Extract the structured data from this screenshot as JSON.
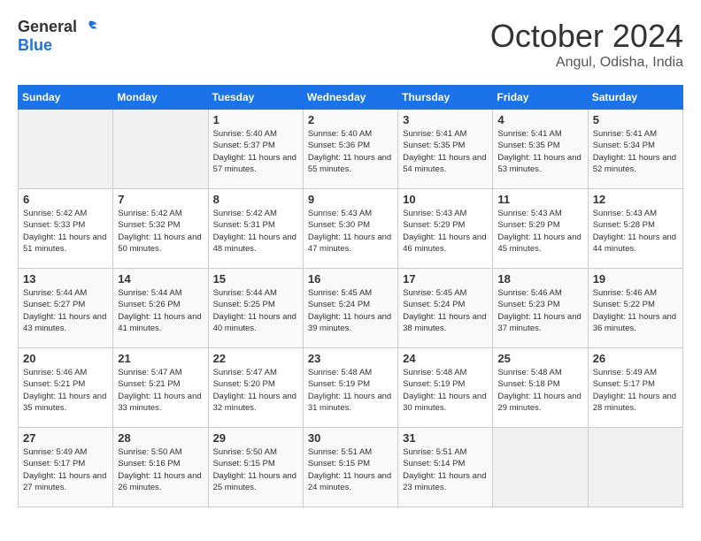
{
  "logo": {
    "general": "General",
    "blue": "Blue"
  },
  "header": {
    "month": "October 2024",
    "location": "Angul, Odisha, India"
  },
  "weekdays": [
    "Sunday",
    "Monday",
    "Tuesday",
    "Wednesday",
    "Thursday",
    "Friday",
    "Saturday"
  ],
  "weeks": [
    [
      {
        "day": "",
        "info": ""
      },
      {
        "day": "",
        "info": ""
      },
      {
        "day": "1",
        "info": "Sunrise: 5:40 AM\nSunset: 5:37 PM\nDaylight: 11 hours and 57 minutes."
      },
      {
        "day": "2",
        "info": "Sunrise: 5:40 AM\nSunset: 5:36 PM\nDaylight: 11 hours and 55 minutes."
      },
      {
        "day": "3",
        "info": "Sunrise: 5:41 AM\nSunset: 5:35 PM\nDaylight: 11 hours and 54 minutes."
      },
      {
        "day": "4",
        "info": "Sunrise: 5:41 AM\nSunset: 5:35 PM\nDaylight: 11 hours and 53 minutes."
      },
      {
        "day": "5",
        "info": "Sunrise: 5:41 AM\nSunset: 5:34 PM\nDaylight: 11 hours and 52 minutes."
      }
    ],
    [
      {
        "day": "6",
        "info": "Sunrise: 5:42 AM\nSunset: 5:33 PM\nDaylight: 11 hours and 51 minutes."
      },
      {
        "day": "7",
        "info": "Sunrise: 5:42 AM\nSunset: 5:32 PM\nDaylight: 11 hours and 50 minutes."
      },
      {
        "day": "8",
        "info": "Sunrise: 5:42 AM\nSunset: 5:31 PM\nDaylight: 11 hours and 48 minutes."
      },
      {
        "day": "9",
        "info": "Sunrise: 5:43 AM\nSunset: 5:30 PM\nDaylight: 11 hours and 47 minutes."
      },
      {
        "day": "10",
        "info": "Sunrise: 5:43 AM\nSunset: 5:29 PM\nDaylight: 11 hours and 46 minutes."
      },
      {
        "day": "11",
        "info": "Sunrise: 5:43 AM\nSunset: 5:29 PM\nDaylight: 11 hours and 45 minutes."
      },
      {
        "day": "12",
        "info": "Sunrise: 5:43 AM\nSunset: 5:28 PM\nDaylight: 11 hours and 44 minutes."
      }
    ],
    [
      {
        "day": "13",
        "info": "Sunrise: 5:44 AM\nSunset: 5:27 PM\nDaylight: 11 hours and 43 minutes."
      },
      {
        "day": "14",
        "info": "Sunrise: 5:44 AM\nSunset: 5:26 PM\nDaylight: 11 hours and 41 minutes."
      },
      {
        "day": "15",
        "info": "Sunrise: 5:44 AM\nSunset: 5:25 PM\nDaylight: 11 hours and 40 minutes."
      },
      {
        "day": "16",
        "info": "Sunrise: 5:45 AM\nSunset: 5:24 PM\nDaylight: 11 hours and 39 minutes."
      },
      {
        "day": "17",
        "info": "Sunrise: 5:45 AM\nSunset: 5:24 PM\nDaylight: 11 hours and 38 minutes."
      },
      {
        "day": "18",
        "info": "Sunrise: 5:46 AM\nSunset: 5:23 PM\nDaylight: 11 hours and 37 minutes."
      },
      {
        "day": "19",
        "info": "Sunrise: 5:46 AM\nSunset: 5:22 PM\nDaylight: 11 hours and 36 minutes."
      }
    ],
    [
      {
        "day": "20",
        "info": "Sunrise: 5:46 AM\nSunset: 5:21 PM\nDaylight: 11 hours and 35 minutes."
      },
      {
        "day": "21",
        "info": "Sunrise: 5:47 AM\nSunset: 5:21 PM\nDaylight: 11 hours and 33 minutes."
      },
      {
        "day": "22",
        "info": "Sunrise: 5:47 AM\nSunset: 5:20 PM\nDaylight: 11 hours and 32 minutes."
      },
      {
        "day": "23",
        "info": "Sunrise: 5:48 AM\nSunset: 5:19 PM\nDaylight: 11 hours and 31 minutes."
      },
      {
        "day": "24",
        "info": "Sunrise: 5:48 AM\nSunset: 5:19 PM\nDaylight: 11 hours and 30 minutes."
      },
      {
        "day": "25",
        "info": "Sunrise: 5:48 AM\nSunset: 5:18 PM\nDaylight: 11 hours and 29 minutes."
      },
      {
        "day": "26",
        "info": "Sunrise: 5:49 AM\nSunset: 5:17 PM\nDaylight: 11 hours and 28 minutes."
      }
    ],
    [
      {
        "day": "27",
        "info": "Sunrise: 5:49 AM\nSunset: 5:17 PM\nDaylight: 11 hours and 27 minutes."
      },
      {
        "day": "28",
        "info": "Sunrise: 5:50 AM\nSunset: 5:16 PM\nDaylight: 11 hours and 26 minutes."
      },
      {
        "day": "29",
        "info": "Sunrise: 5:50 AM\nSunset: 5:15 PM\nDaylight: 11 hours and 25 minutes."
      },
      {
        "day": "30",
        "info": "Sunrise: 5:51 AM\nSunset: 5:15 PM\nDaylight: 11 hours and 24 minutes."
      },
      {
        "day": "31",
        "info": "Sunrise: 5:51 AM\nSunset: 5:14 PM\nDaylight: 11 hours and 23 minutes."
      },
      {
        "day": "",
        "info": ""
      },
      {
        "day": "",
        "info": ""
      }
    ]
  ]
}
